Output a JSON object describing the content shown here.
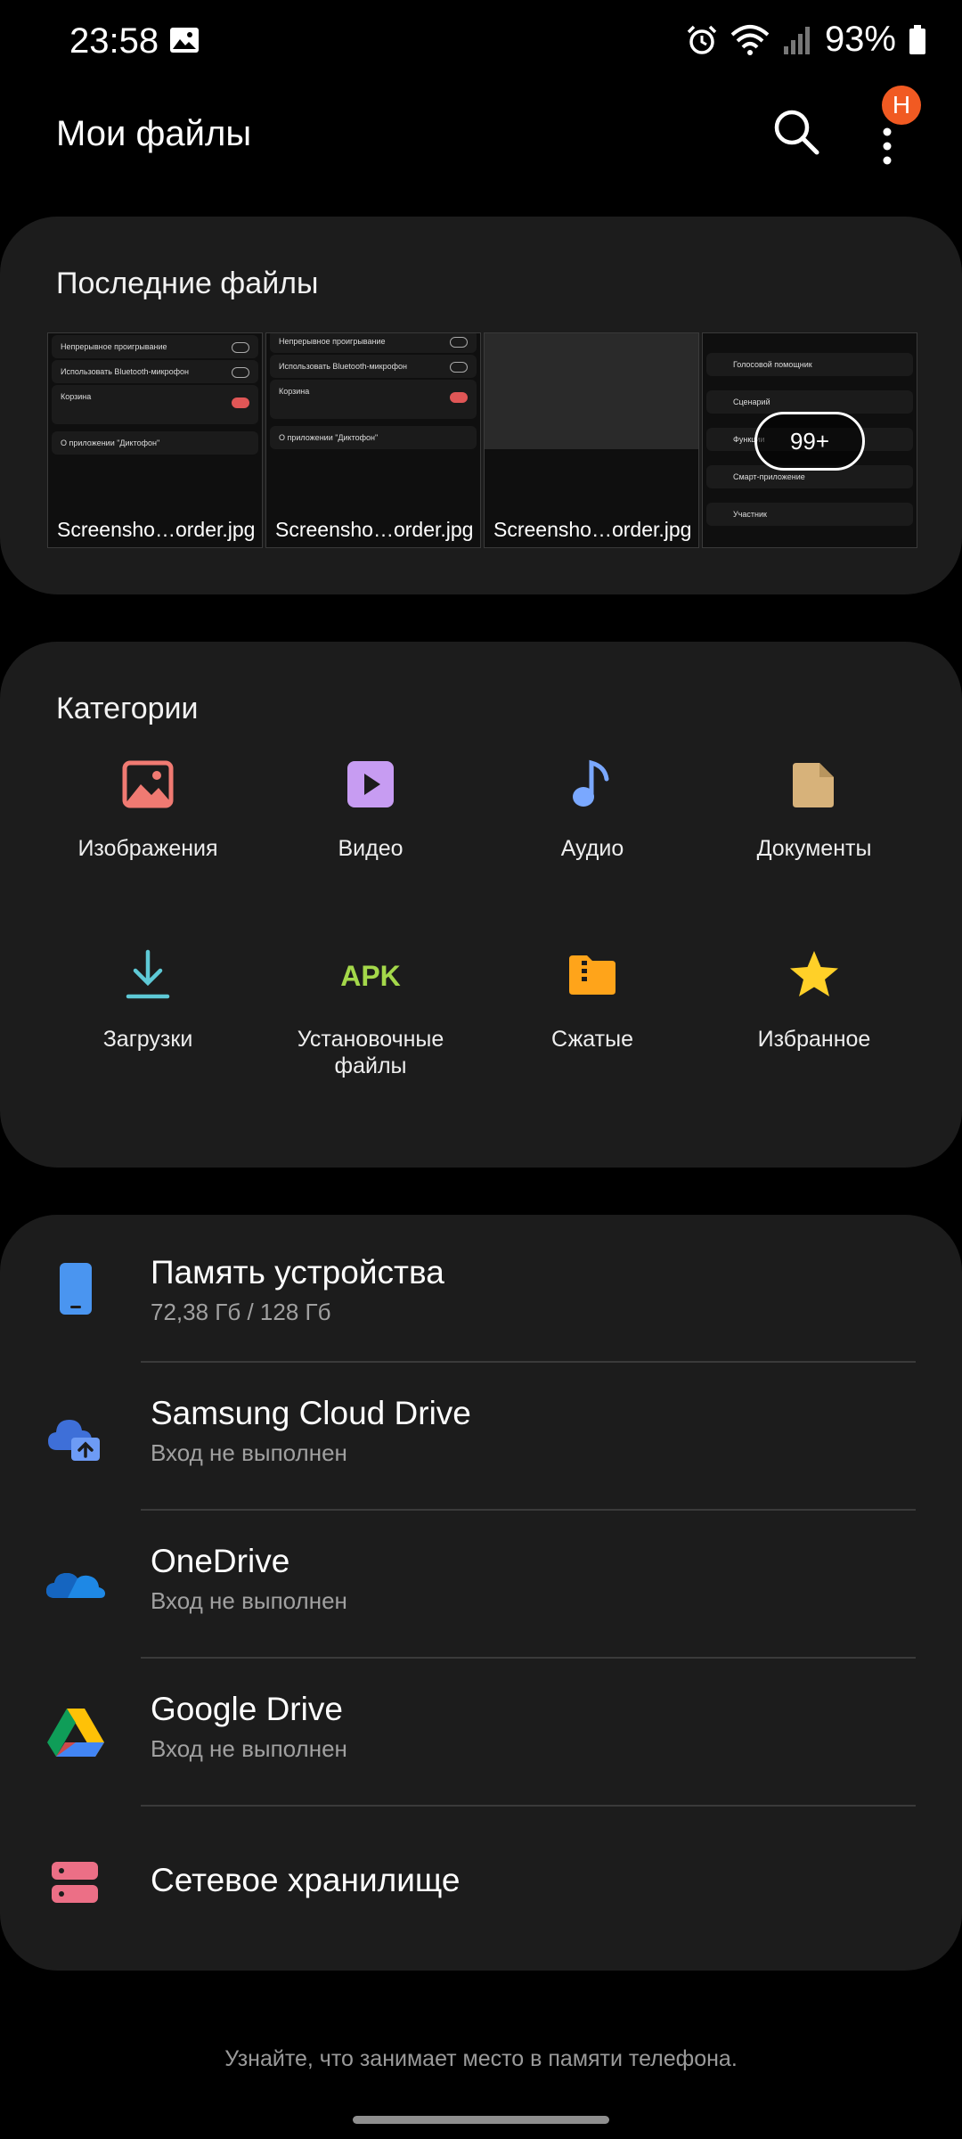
{
  "status": {
    "time": "23:58",
    "battery": "93%"
  },
  "header": {
    "title": "Мои файлы",
    "badge": "Н"
  },
  "recent": {
    "title": "Последние файлы",
    "files": [
      {
        "name": "Screensho…order.jpg",
        "rows": [
          "Непрерывное проигрывание",
          "Использовать Bluetooth-микрофон",
          "Корзина",
          "О приложении \"Диктофон\""
        ]
      },
      {
        "name": "Screensho…order.jpg",
        "rows": [
          "Непрерывное проигрывание",
          "Использовать Bluetooth-микрофон",
          "Корзина",
          "О приложении \"Диктофон\""
        ]
      },
      {
        "name": "Screensho…order.jpg"
      },
      {
        "overlay": "99+",
        "rows": [
          "Голосовой помощник",
          "Сценарий",
          "Функции",
          "Смарт-приложение",
          "Участник"
        ]
      }
    ]
  },
  "categories": {
    "title": "Категории",
    "items": [
      {
        "label": "Изображения",
        "icon": "image-icon",
        "color": "#f07a72"
      },
      {
        "label": "Видео",
        "icon": "video-icon",
        "color": "#c79cf2"
      },
      {
        "label": "Аудио",
        "icon": "music-note-icon",
        "color": "#7aa8ff"
      },
      {
        "label": "Документы",
        "icon": "document-icon",
        "color": "#d7b27a"
      },
      {
        "label": "Загрузки",
        "icon": "download-icon",
        "color": "#5ec9d6"
      },
      {
        "label": "Установочные файлы",
        "icon": "apk-icon",
        "icon_text": "APK",
        "color": "#a4d84a"
      },
      {
        "label": "Сжатые",
        "icon": "zip-folder-icon",
        "color": "#ffa41a"
      },
      {
        "label": "Избранное",
        "icon": "star-icon",
        "color": "#ffd028"
      }
    ]
  },
  "storage": {
    "items": [
      {
        "title": "Память устройства",
        "subtitle": "72,38 Гб / 128 Гб",
        "icon": "phone-storage-icon"
      },
      {
        "title": "Samsung Cloud Drive",
        "subtitle": "Вход не выполнен",
        "icon": "samsung-cloud-icon"
      },
      {
        "title": "OneDrive",
        "subtitle": "Вход не выполнен",
        "icon": "onedrive-icon"
      },
      {
        "title": "Google Drive",
        "subtitle": "Вход не выполнен",
        "icon": "google-drive-icon"
      },
      {
        "title": "Сетевое хранилище",
        "icon": "network-storage-icon"
      }
    ]
  },
  "footer": {
    "hint": "Узнайте, что занимает место в памяти телефона."
  }
}
